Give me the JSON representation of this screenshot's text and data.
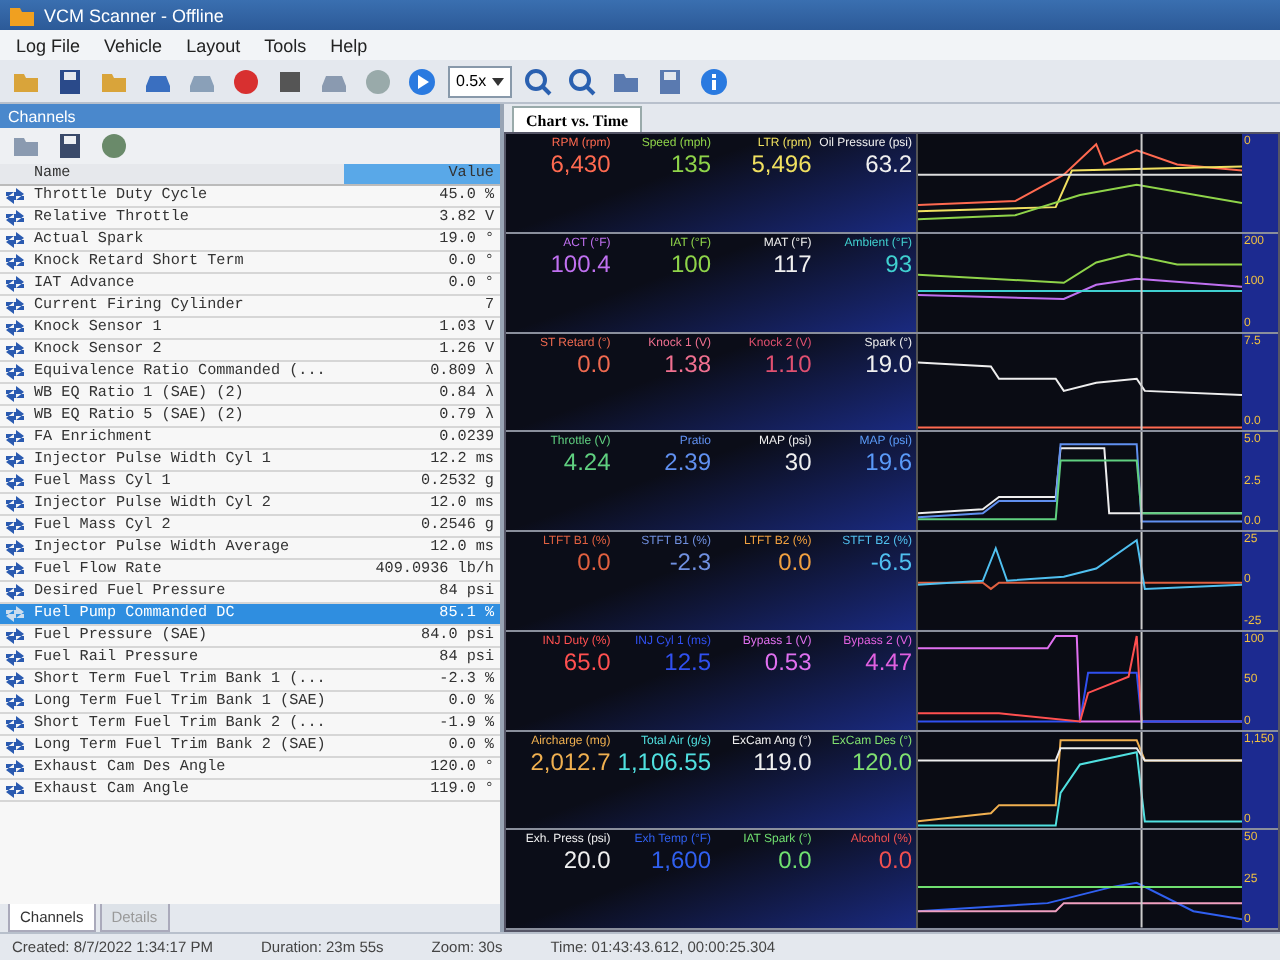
{
  "window": {
    "title": "VCM Scanner - Offline"
  },
  "menu": [
    "Log File",
    "Vehicle",
    "Layout",
    "Tools",
    "Help"
  ],
  "toolbar": {
    "speed": "0.5x"
  },
  "channels_panel": {
    "title": "Channels",
    "columns": [
      "Name",
      "Value"
    ],
    "rows": [
      {
        "name": "Throttle Duty Cycle",
        "value": "45.0 %",
        "selected": false
      },
      {
        "name": "Relative Throttle",
        "value": "3.82 V",
        "selected": false
      },
      {
        "name": "Actual Spark",
        "value": "19.0 °",
        "selected": false
      },
      {
        "name": "Knock Retard Short Term",
        "value": "0.0 °",
        "selected": false
      },
      {
        "name": "IAT Advance",
        "value": "0.0 °",
        "selected": false
      },
      {
        "name": "Current Firing Cylinder",
        "value": "7",
        "selected": false
      },
      {
        "name": "Knock Sensor 1",
        "value": "1.03 V",
        "selected": false
      },
      {
        "name": "Knock Sensor 2",
        "value": "1.26 V",
        "selected": false
      },
      {
        "name": "Equivalence Ratio Commanded (...",
        "value": "0.809 λ",
        "selected": false
      },
      {
        "name": "WB EQ Ratio 1 (SAE) (2)",
        "value": "0.84 λ",
        "selected": false
      },
      {
        "name": "WB EQ Ratio 5 (SAE) (2)",
        "value": "0.79 λ",
        "selected": false
      },
      {
        "name": "FA Enrichment",
        "value": "0.0239",
        "selected": false
      },
      {
        "name": "Injector Pulse Width Cyl 1",
        "value": "12.2 ms",
        "selected": false
      },
      {
        "name": "Fuel Mass Cyl 1",
        "value": "0.2532 g",
        "selected": false
      },
      {
        "name": "Injector Pulse Width Cyl 2",
        "value": "12.0 ms",
        "selected": false
      },
      {
        "name": "Fuel Mass Cyl 2",
        "value": "0.2546 g",
        "selected": false
      },
      {
        "name": "Injector Pulse Width Average",
        "value": "12.0 ms",
        "selected": false
      },
      {
        "name": "Fuel Flow Rate",
        "value": "409.0936 lb/h",
        "selected": false
      },
      {
        "name": "Desired Fuel Pressure",
        "value": "84 psi",
        "selected": false
      },
      {
        "name": "Fuel Pump Commanded DC",
        "value": "85.1 %",
        "selected": true
      },
      {
        "name": "Fuel Pressure (SAE)",
        "value": "84.0 psi",
        "selected": false
      },
      {
        "name": "Fuel Rail Pressure",
        "value": "84 psi",
        "selected": false
      },
      {
        "name": "Short Term Fuel Trim Bank 1 (...",
        "value": "-2.3 %",
        "selected": false
      },
      {
        "name": "Long Term Fuel Trim Bank 1 (SAE)",
        "value": "0.0 %",
        "selected": false
      },
      {
        "name": "Short Term Fuel Trim Bank 2 (...",
        "value": "-1.9 %",
        "selected": false
      },
      {
        "name": "Long Term Fuel Trim Bank 2 (SAE)",
        "value": "0.0 %",
        "selected": false
      },
      {
        "name": "Exhaust Cam Des Angle",
        "value": "120.0 °",
        "selected": false
      },
      {
        "name": "Exhaust Cam Angle",
        "value": "119.0 °",
        "selected": false
      }
    ],
    "tabs": [
      {
        "label": "Channels",
        "selected": true
      },
      {
        "label": "Details",
        "selected": false
      }
    ]
  },
  "chart_tab": {
    "label": "Chart vs. Time",
    "selected": true
  },
  "gauge_rows": [
    {
      "gauges": [
        {
          "label": "RPM (rpm)",
          "value": "6,430",
          "color": "#ff6a50"
        },
        {
          "label": "Speed (mph)",
          "value": "135",
          "color": "#8fd44a"
        },
        {
          "label": "LTR (rpm)",
          "value": "5,496",
          "color": "#f0e060"
        },
        {
          "label": "Oil Pressure (psi)",
          "value": "63.2",
          "color": "#f0f0f0"
        }
      ],
      "scale": [
        "0"
      ]
    },
    {
      "gauges": [
        {
          "label": "ACT (°F)",
          "value": "100.4",
          "color": "#c070f0"
        },
        {
          "label": "IAT (°F)",
          "value": "100",
          "color": "#8fd44a"
        },
        {
          "label": "MAT (°F)",
          "value": "117",
          "color": "#f0f0f0"
        },
        {
          "label": "Ambient (°F)",
          "value": "93",
          "color": "#40d0d0"
        }
      ],
      "scale": [
        "200",
        "100",
        "0"
      ]
    },
    {
      "gauges": [
        {
          "label": "ST Retard (°)",
          "value": "0.0",
          "color": "#f06a50"
        },
        {
          "label": "Knock 1 (V)",
          "value": "1.38",
          "color": "#f07090"
        },
        {
          "label": "Knock 2 (V)",
          "value": "1.10",
          "color": "#e05070"
        },
        {
          "label": "Spark (°)",
          "value": "19.0",
          "color": "#f0f0f0"
        }
      ],
      "scale": [
        "7.5",
        "0.0"
      ]
    },
    {
      "gauges": [
        {
          "label": "Throttle (V)",
          "value": "4.24",
          "color": "#60d080"
        },
        {
          "label": "Pratio",
          "value": "2.39",
          "color": "#6090f0"
        },
        {
          "label": "MAP (psi)",
          "value": "30",
          "color": "#f0f0f0"
        },
        {
          "label": "MAP (psi)",
          "value": "19.6",
          "color": "#5a9af8"
        }
      ],
      "scale": [
        "5.0",
        "2.5",
        "0.0"
      ]
    },
    {
      "gauges": [
        {
          "label": "LTFT B1 (%)",
          "value": "0.0",
          "color": "#e06040"
        },
        {
          "label": "STFT B1 (%)",
          "value": "-2.3",
          "color": "#7090e0"
        },
        {
          "label": "LTFT B2 (%)",
          "value": "0.0",
          "color": "#f0a040"
        },
        {
          "label": "STFT B2 (%)",
          "value": "-6.5",
          "color": "#50c0f0"
        }
      ],
      "scale": [
        "25",
        "0",
        "-25"
      ]
    },
    {
      "gauges": [
        {
          "label": "INJ Duty (%)",
          "value": "65.0",
          "color": "#ff5050"
        },
        {
          "label": "INJ Cyl 1 (ms)",
          "value": "12.5",
          "color": "#3050f0"
        },
        {
          "label": "Bypass 1 (V)",
          "value": "0.53",
          "color": "#e070f0"
        },
        {
          "label": "Bypass 2 (V)",
          "value": "4.47",
          "color": "#e060e0"
        }
      ],
      "scale": [
        "100",
        "50",
        "0"
      ]
    },
    {
      "gauges": [
        {
          "label": "Aircharge (mg)",
          "value": "2,012.7",
          "color": "#f0b050"
        },
        {
          "label": "Total Air (g/s)",
          "value": "1,106.55",
          "color": "#50e0e0"
        },
        {
          "label": "ExCam Ang (°)",
          "value": "119.0",
          "color": "#f0f0f0"
        },
        {
          "label": "ExCam Des (°)",
          "value": "120.0",
          "color": "#80e070"
        }
      ],
      "scale": [
        "1,150",
        "0"
      ]
    },
    {
      "gauges": [
        {
          "label": "Exh. Press (psi)",
          "value": "20.0",
          "color": "#f0f0f0"
        },
        {
          "label": "Exh Temp (°F)",
          "value": "1,600",
          "color": "#3060f0"
        },
        {
          "label": "IAT Spark (°)",
          "value": "0.0",
          "color": "#70e070"
        },
        {
          "label": "Alcohol (%)",
          "value": "0.0",
          "color": "#f05050"
        }
      ],
      "scale": [
        "50",
        "25",
        "0"
      ]
    }
  ],
  "status_bar": [
    "Created: 8/7/2022 1:34:17 PM",
    "Duration: 23m 55s",
    "Zoom: 30s",
    "Time: 01:43:43.612, 00:00:25.304"
  ]
}
